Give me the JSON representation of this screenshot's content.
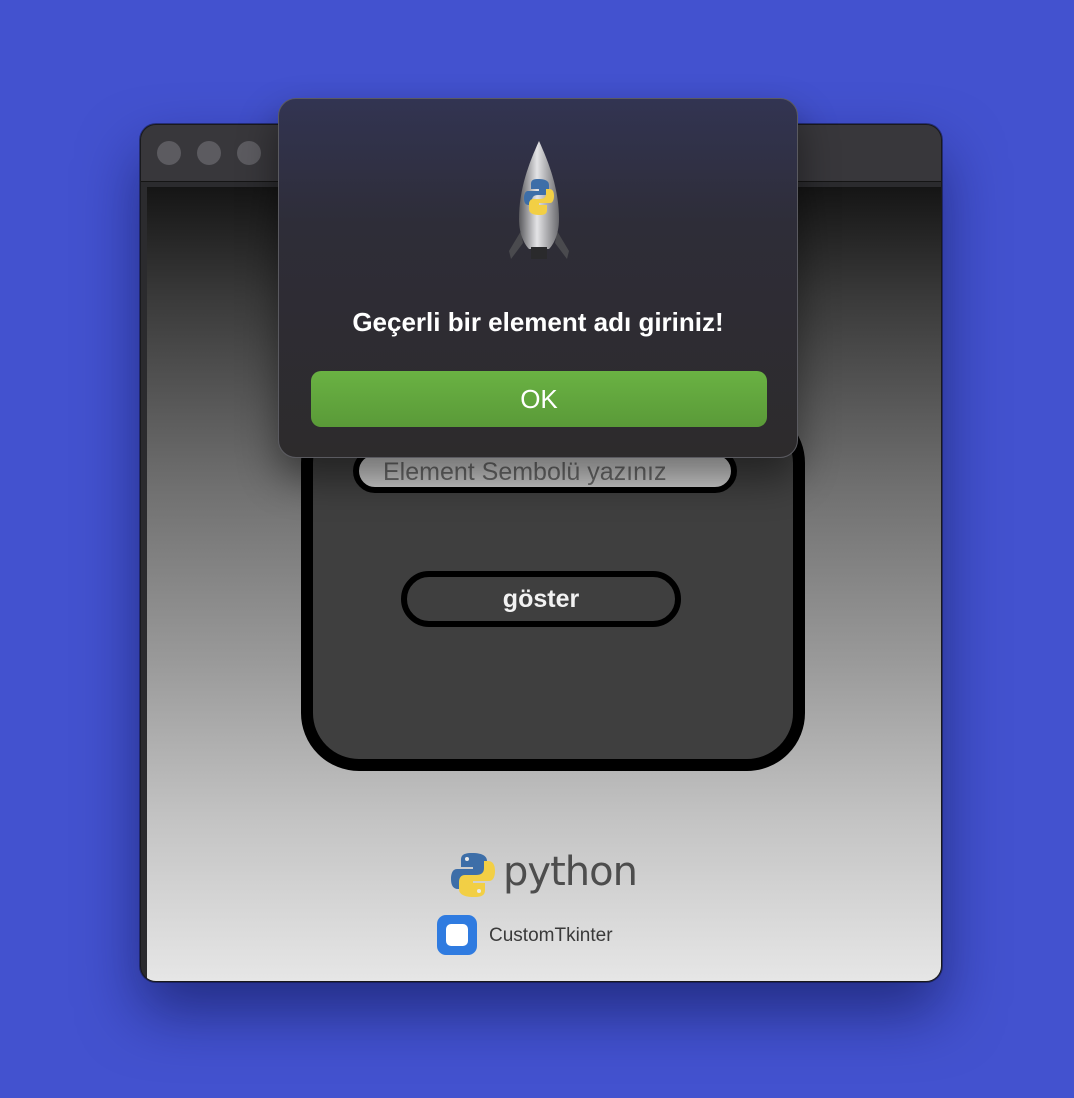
{
  "dialog": {
    "message": "Geçerli bir element adı giriniz!",
    "ok_label": "OK",
    "icon": "python-launcher-rocket-icon"
  },
  "form": {
    "symbol_placeholder": "Element Sembolü yazınız",
    "show_button_label": "göster"
  },
  "logos": {
    "python_text": "python",
    "customtkinter_text": "CustomTkinter"
  },
  "colors": {
    "desktop": "#4352cf",
    "ok_button": "#62a63e",
    "card": "#3f3f3f"
  }
}
